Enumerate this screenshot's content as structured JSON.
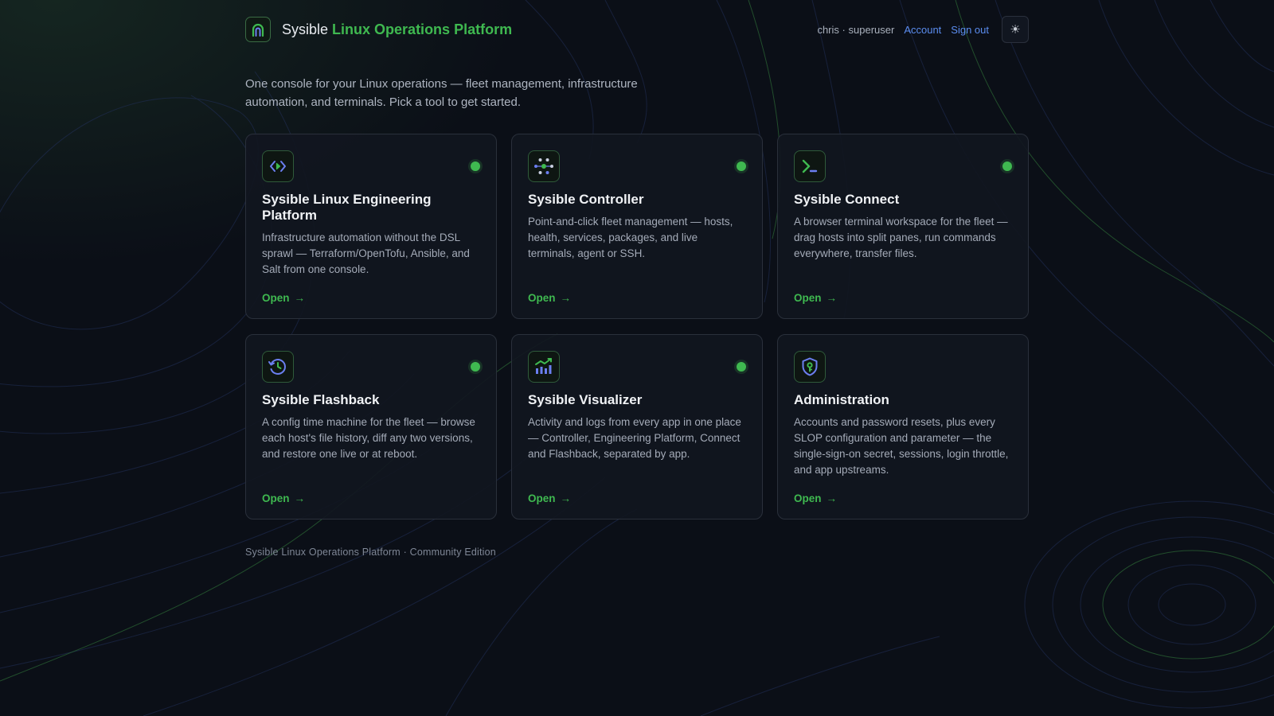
{
  "app": {
    "brand_name": "Sysible",
    "brand_accent": "Linux Operations Platform",
    "logo_icon": "arch-logo-icon"
  },
  "header": {
    "user": "chris",
    "role": "superuser",
    "separator": "·",
    "account_label": "Account",
    "signout_label": "Sign out",
    "theme_icon": "☀"
  },
  "intro": "One console for your Linux operations — fleet management, infrastructure automation, and terminals. Pick a tool to get started.",
  "cards": [
    {
      "title": "Sysible Linux Engineering Platform",
      "description": "Infrastructure automation without the DSL sprawl — Terraform/OpenTofu, Ansible, and Salt from one console.",
      "open_label": "Open",
      "arrow": "→",
      "icon": "code-brackets-icon",
      "status": "online"
    },
    {
      "title": "Sysible Controller",
      "description": "Point-and-click fleet management — hosts, health, services, packages, and live terminals, agent or SSH.",
      "open_label": "Open",
      "arrow": "→",
      "icon": "network-nodes-icon",
      "status": "online"
    },
    {
      "title": "Sysible Connect",
      "description": "A browser terminal workspace for the fleet — drag hosts into split panes, run commands everywhere, transfer files.",
      "open_label": "Open",
      "arrow": "→",
      "icon": "terminal-prompt-icon",
      "status": "online"
    },
    {
      "title": "Sysible Flashback",
      "description": "A config time machine for the fleet — browse each host's file history, diff any two versions, and restore one live or at reboot.",
      "open_label": "Open",
      "arrow": "→",
      "icon": "history-clock-icon",
      "status": "online"
    },
    {
      "title": "Sysible Visualizer",
      "description": "Activity and logs from every app in one place — Controller, Engineering Platform, Connect and Flashback, separated by app.",
      "open_label": "Open",
      "arrow": "→",
      "icon": "chart-trend-icon",
      "status": "online"
    },
    {
      "title": "Administration",
      "description": "Accounts and password resets, plus every SLOP configuration and parameter — the single-sign-on secret, sessions, login throttle, and app upstreams.",
      "open_label": "Open",
      "arrow": "→",
      "icon": "shield-key-icon",
      "status": "none"
    }
  ],
  "footer": {
    "product": "Sysible Linux Operations Platform",
    "separator": "·",
    "edition": "Community Edition"
  },
  "colors": {
    "accent_green": "#3fb950",
    "link_blue": "#5b8def",
    "background": "#0b0f17",
    "card_border": "#2a303b"
  }
}
